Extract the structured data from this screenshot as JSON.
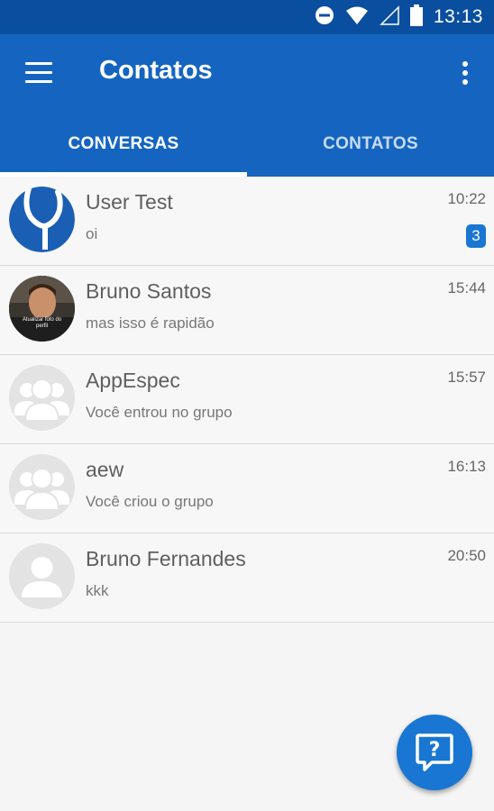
{
  "status_bar": {
    "time": "13:13",
    "icons": [
      "do-not-disturb-icon",
      "wifi-icon",
      "signal-icon",
      "battery-icon"
    ]
  },
  "app_bar": {
    "title": "Contatos",
    "menu_icon": "hamburger-menu-icon",
    "more_icon": "more-vert-icon"
  },
  "tabs": [
    {
      "label": "CONVERSAS",
      "active": true
    },
    {
      "label": "CONTATOS",
      "active": false
    }
  ],
  "conversations": [
    {
      "name": "User Test",
      "preview": "oi",
      "time": "10:22",
      "unread": "3",
      "avatar": "logo-avatar"
    },
    {
      "name": "Bruno Santos",
      "preview": "mas isso é rapidão",
      "time": "15:44",
      "avatar": "photo-avatar",
      "avatar_caption": "Atualizar foto do perfil"
    },
    {
      "name": "AppEspec",
      "preview": "Você entrou no grupo",
      "time": "15:57",
      "avatar": "group-avatar-icon"
    },
    {
      "name": "aew",
      "preview": "Você criou o grupo",
      "time": "16:13",
      "avatar": "group-avatar-icon"
    },
    {
      "name": "Bruno Fernandes",
      "preview": "kkk",
      "time": "20:50",
      "avatar": "person-avatar-icon"
    }
  ],
  "fab": {
    "icon": "help-chat-icon",
    "symbol": "?"
  },
  "colors": {
    "status_bar": "#0a4ea0",
    "primary": "#1565c0",
    "accent": "#1976d2",
    "background": "#f5f5f5"
  }
}
